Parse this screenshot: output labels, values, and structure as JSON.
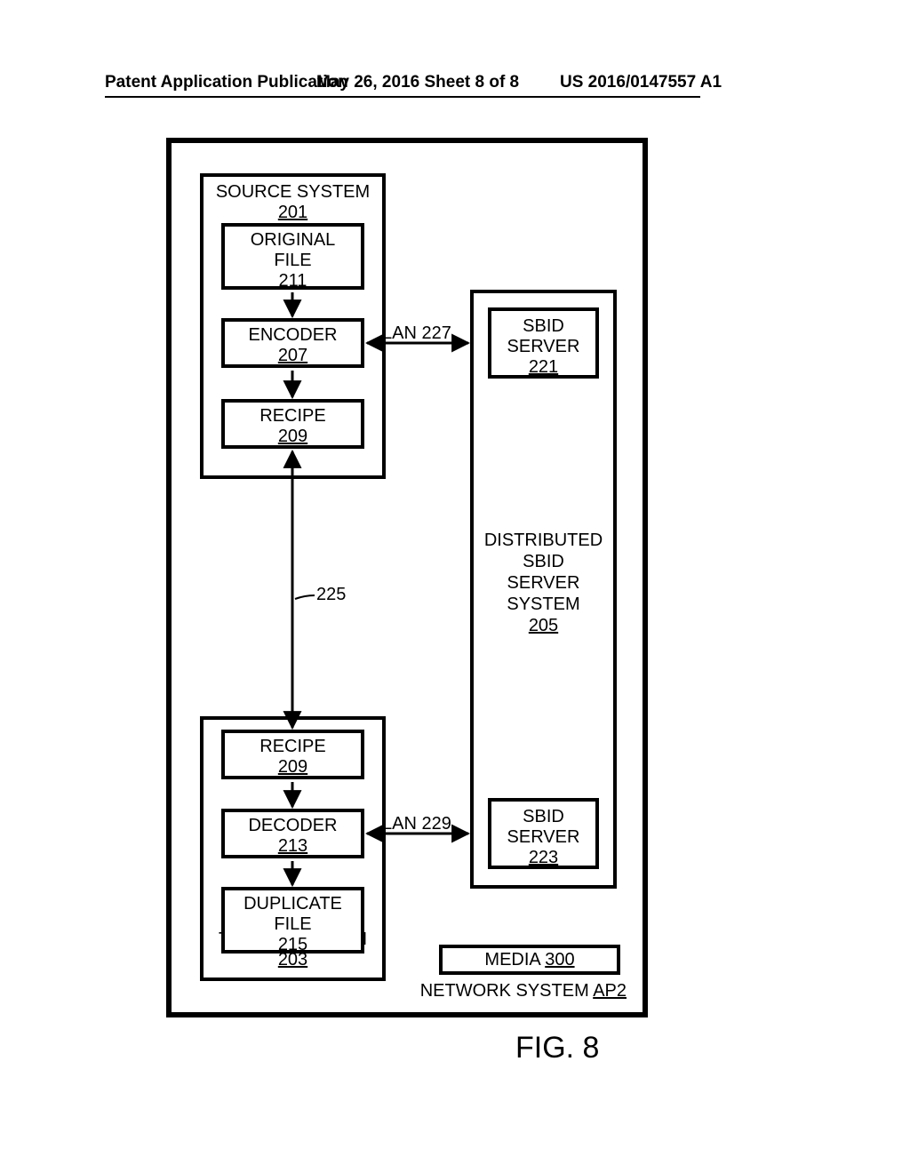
{
  "header": {
    "left": "Patent Application Publication",
    "mid": "May 26, 2016  Sheet 8 of 8",
    "right": "US 2016/0147557 A1"
  },
  "figure_label": "FIG. 8",
  "outer": {
    "network_system_label": "NETWORK SYSTEM",
    "network_system_ref": "AP2"
  },
  "source_system": {
    "title": "SOURCE SYSTEM",
    "ref": "201",
    "original_file": {
      "title": "ORIGINAL FILE",
      "ref": "211"
    },
    "encoder": {
      "title": "ENCODER",
      "ref": "207"
    },
    "recipe": {
      "title": "RECIPE",
      "ref": "209"
    }
  },
  "target_system": {
    "title": "TARGET SYSTEM",
    "ref": "203",
    "recipe": {
      "title": "RECIPE",
      "ref": "209"
    },
    "decoder": {
      "title": "DECODER",
      "ref": "213"
    },
    "duplicate_file": {
      "title": "DUPLICATE FILE",
      "ref": "215"
    }
  },
  "sb_system": {
    "title": "DISTRIBUTED SBID SERVER SYSTEM",
    "ref": "205",
    "server_upper": {
      "title": "SBID SERVER",
      "ref": "221"
    },
    "server_lower": {
      "title": "SBID SERVER",
      "ref": "223"
    }
  },
  "media": {
    "title": "MEDIA",
    "ref": "300"
  },
  "links": {
    "lan_upper": "LAN 227",
    "lan_lower": "LAN 229",
    "recipe_link_ref": "225"
  }
}
